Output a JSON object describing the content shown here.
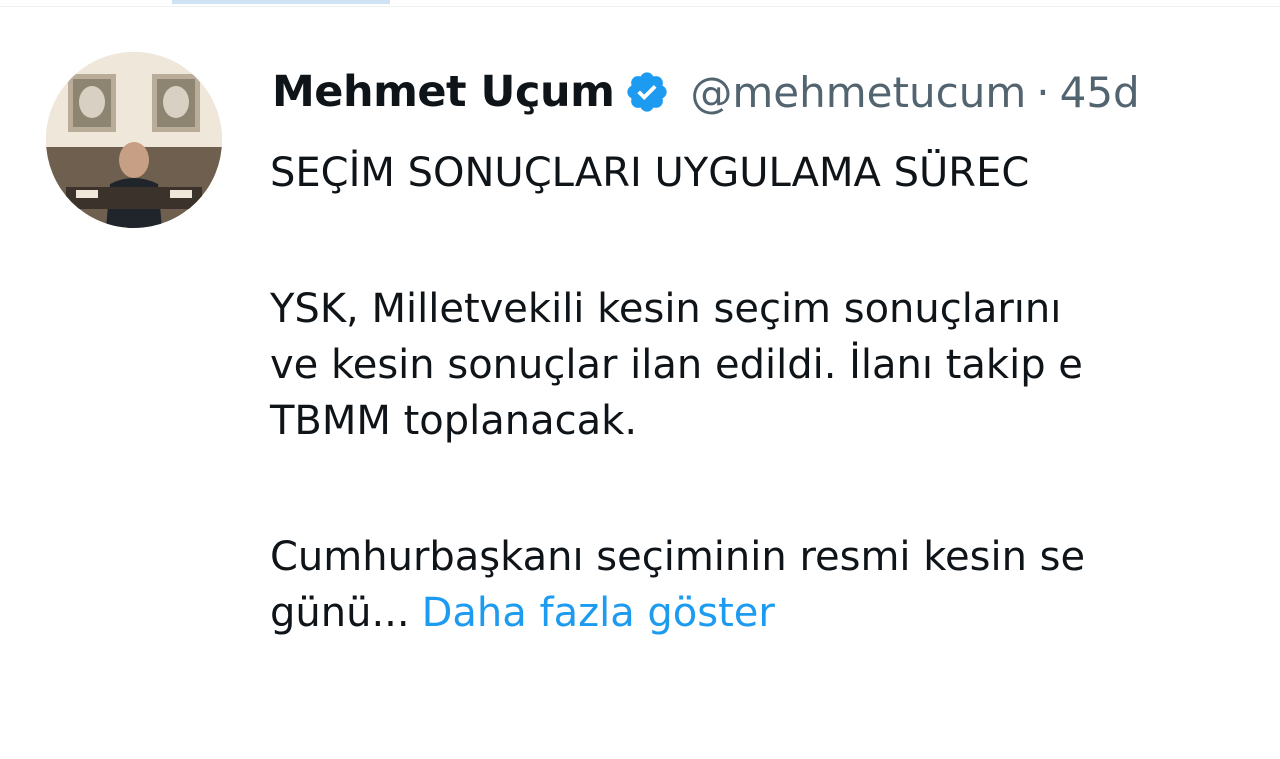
{
  "tweet": {
    "author_name": "Mehmet Uçum",
    "handle": "@mehmetucum",
    "separator": "·",
    "time": "45d",
    "verified_icon": "verified-badge-icon",
    "paragraph1": "SEÇİM SONUÇLARI UYGULAMA SÜREC",
    "paragraph2": {
      "line1": "YSK, Milletvekili kesin seçim sonuçlarını",
      "line2": "ve kesin sonuçlar ilan edildi. İlanı takip e",
      "line3": "TBMM toplanacak."
    },
    "paragraph3": {
      "line1": "Cumhurbaşkanı seçiminin resmi kesin se",
      "line2": "günü..."
    },
    "show_more_label": "Daha fazla göster"
  },
  "colors": {
    "text": "#0f1419",
    "secondary": "#536471",
    "link": "#1d9bf0",
    "verified": "#1d9bf0"
  }
}
